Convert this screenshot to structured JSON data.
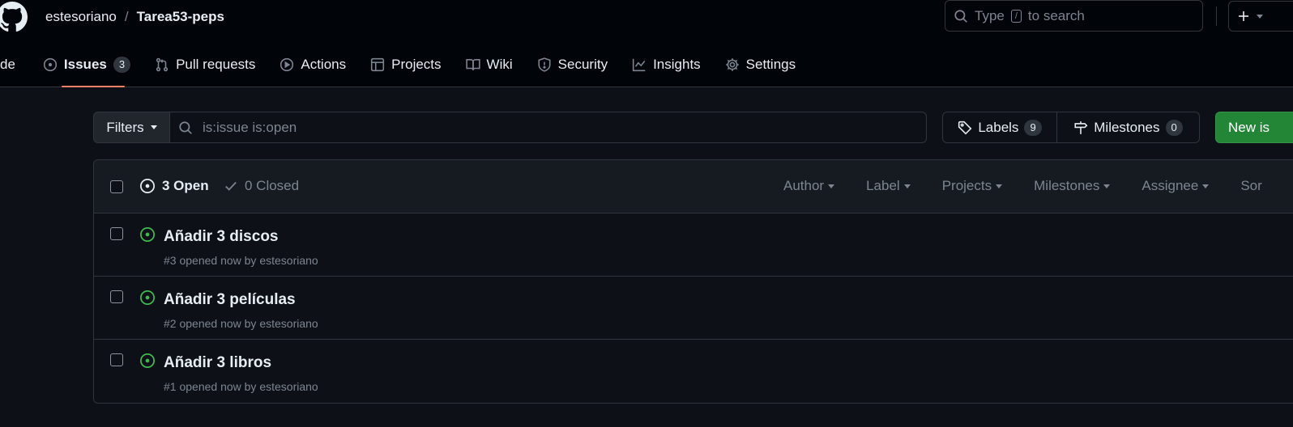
{
  "header": {
    "owner": "estesoriano",
    "separator": "/",
    "repo": "Tarea53-peps",
    "search": {
      "prefix": "Type",
      "key": "/",
      "suffix": "to search"
    }
  },
  "nav": {
    "partial_first": "de",
    "tabs": [
      {
        "label": "Issues",
        "count": "3",
        "icon": "issue-opened-icon",
        "selected": true
      },
      {
        "label": "Pull requests",
        "icon": "git-pull-request-icon"
      },
      {
        "label": "Actions",
        "icon": "play-icon"
      },
      {
        "label": "Projects",
        "icon": "table-icon"
      },
      {
        "label": "Wiki",
        "icon": "book-icon"
      },
      {
        "label": "Security",
        "icon": "shield-icon"
      },
      {
        "label": "Insights",
        "icon": "graph-icon"
      },
      {
        "label": "Settings",
        "icon": "gear-icon"
      }
    ]
  },
  "toolbar": {
    "filters_label": "Filters",
    "query": "is:issue is:open",
    "labels_label": "Labels",
    "labels_count": "9",
    "milestones_label": "Milestones",
    "milestones_count": "0",
    "new_issue_label": "New is"
  },
  "list": {
    "open_label": "3 Open",
    "closed_label": "0 Closed",
    "menus": [
      "Author",
      "Label",
      "Projects",
      "Milestones",
      "Assignee",
      "Sor"
    ],
    "issues": [
      {
        "title": "Añadir 3 discos",
        "meta": "#3 opened now by estesoriano"
      },
      {
        "title": "Añadir 3 películas",
        "meta": "#2 opened now by estesoriano"
      },
      {
        "title": "Añadir 3 libros",
        "meta": "#1 opened now by estesoriano"
      }
    ]
  },
  "colors": {
    "accent_tab": "#f78166",
    "open_green": "#3fb950",
    "primary_button": "#238636",
    "bg": "#0d1117"
  }
}
